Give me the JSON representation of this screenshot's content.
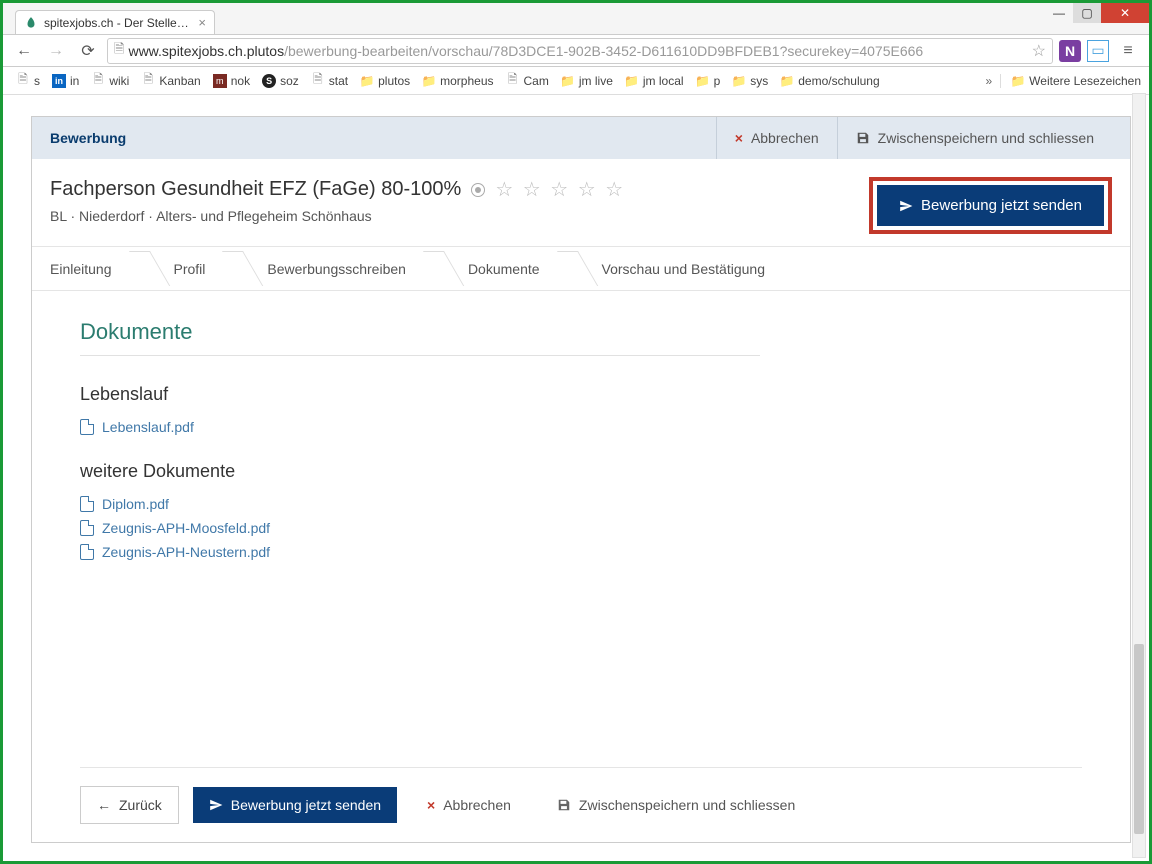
{
  "window": {
    "tab_title": "spitexjobs.ch - Der Stellen…"
  },
  "addressbar": {
    "host": "www.spitexjobs.ch.plutos",
    "path": "/bewerbung-bearbeiten/vorschau/78D3DCE1-902B-3452-D611610DD9BFDEB1?securekey=4075E666"
  },
  "bookmarks": {
    "items": [
      "s",
      "in",
      "wiki",
      "Kanban",
      "nok",
      "soz",
      "stat",
      "plutos",
      "morpheus",
      "Cam",
      "jm live",
      "jm local",
      "p",
      "sys",
      "demo/schulung"
    ],
    "other_label": "Weitere Lesezeichen"
  },
  "modal": {
    "title": "Bewerbung",
    "cancel": "Abbrechen",
    "save_close": "Zwischenspeichern und schliessen"
  },
  "job": {
    "title": "Fachperson Gesundheit EFZ (FaGe) 80-100%",
    "subtitle": "BL · Niederdorf · Alters- und Pflegeheim Schönhaus",
    "send_now": "Bewerbung jetzt senden"
  },
  "crumbs": [
    "Einleitung",
    "Profil",
    "Bewerbungsschreiben",
    "Dokumente",
    "Vorschau und Bestätigung"
  ],
  "docs": {
    "heading": "Dokumente",
    "cv_heading": "Lebenslauf",
    "cv_file": "Lebenslauf.pdf",
    "more_heading": "weitere Dokumente",
    "more_files": [
      "Diplom.pdf",
      "Zeugnis-APH-Moosfeld.pdf",
      "Zeugnis-APH-Neustern.pdf"
    ]
  },
  "footer": {
    "back": "Zurück",
    "send": "Bewerbung jetzt senden",
    "cancel": "Abbrechen",
    "save_close": "Zwischenspeichern und schliessen"
  }
}
